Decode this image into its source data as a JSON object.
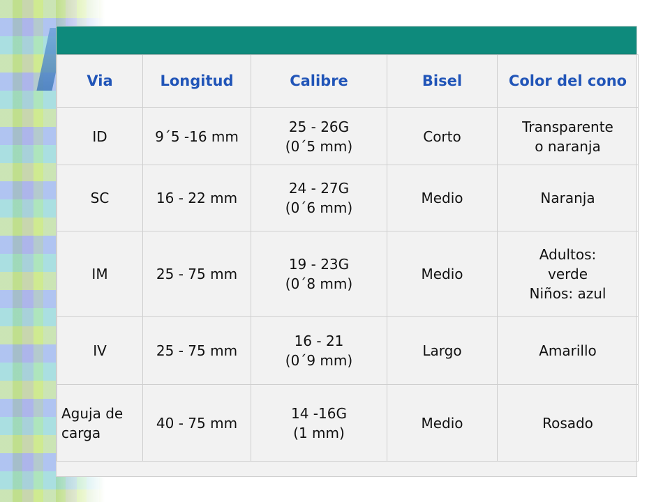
{
  "table": {
    "headers": [
      "Via",
      "Longitud",
      "Calibre",
      "Bisel",
      "Color del cono"
    ],
    "rows": [
      {
        "via": "ID",
        "longitud": "9´5 -16 mm",
        "calibre": [
          "25 - 26G",
          "(0´5 mm)"
        ],
        "bisel": "Corto",
        "color": [
          "Transparente",
          "o naranja"
        ]
      },
      {
        "via": "SC",
        "longitud": "16 - 22 mm",
        "calibre": [
          "24 - 27G",
          "(0´6 mm)"
        ],
        "bisel": "Medio",
        "color": [
          "Naranja"
        ]
      },
      {
        "via": "IM",
        "longitud": "25 - 75 mm",
        "calibre": [
          "19 - 23G",
          "(0´8 mm)"
        ],
        "bisel": "Medio",
        "color": [
          "Adultos:",
          "verde",
          "Niños: azul"
        ]
      },
      {
        "via": "IV",
        "longitud": "25 - 75 mm",
        "calibre": [
          "16 - 21",
          "(0´9 mm)"
        ],
        "bisel": "Largo",
        "color": [
          "Amarillo"
        ]
      },
      {
        "via": [
          "Aguja de",
          "carga"
        ],
        "longitud": "40 - 75 mm",
        "calibre": [
          "14 -16G",
          "(1 mm)"
        ],
        "bisel": "Medio",
        "color": [
          "Rosado"
        ]
      }
    ]
  },
  "colors": {
    "header_bar": "#0e8a7c",
    "header_text": "#2155b8",
    "table_bg": "#f2f2f2"
  }
}
